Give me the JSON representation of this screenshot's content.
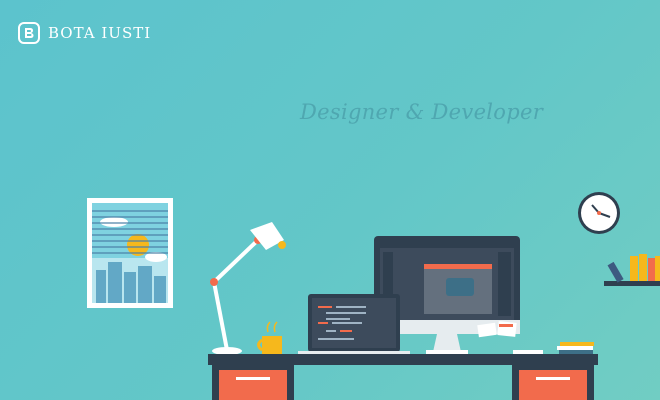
{
  "brand": {
    "name": "BOTA IUSTI",
    "icon": "b-monogram-icon"
  },
  "hero": {
    "tagline": "Designer & Developer"
  },
  "colors": {
    "background": "#63c7c8",
    "tagline": "#4fa7b0",
    "desk": "#2f3f4f",
    "drawer": "#f26b4c",
    "screen": "#3d4b5c",
    "mug": "#f6b81c"
  }
}
